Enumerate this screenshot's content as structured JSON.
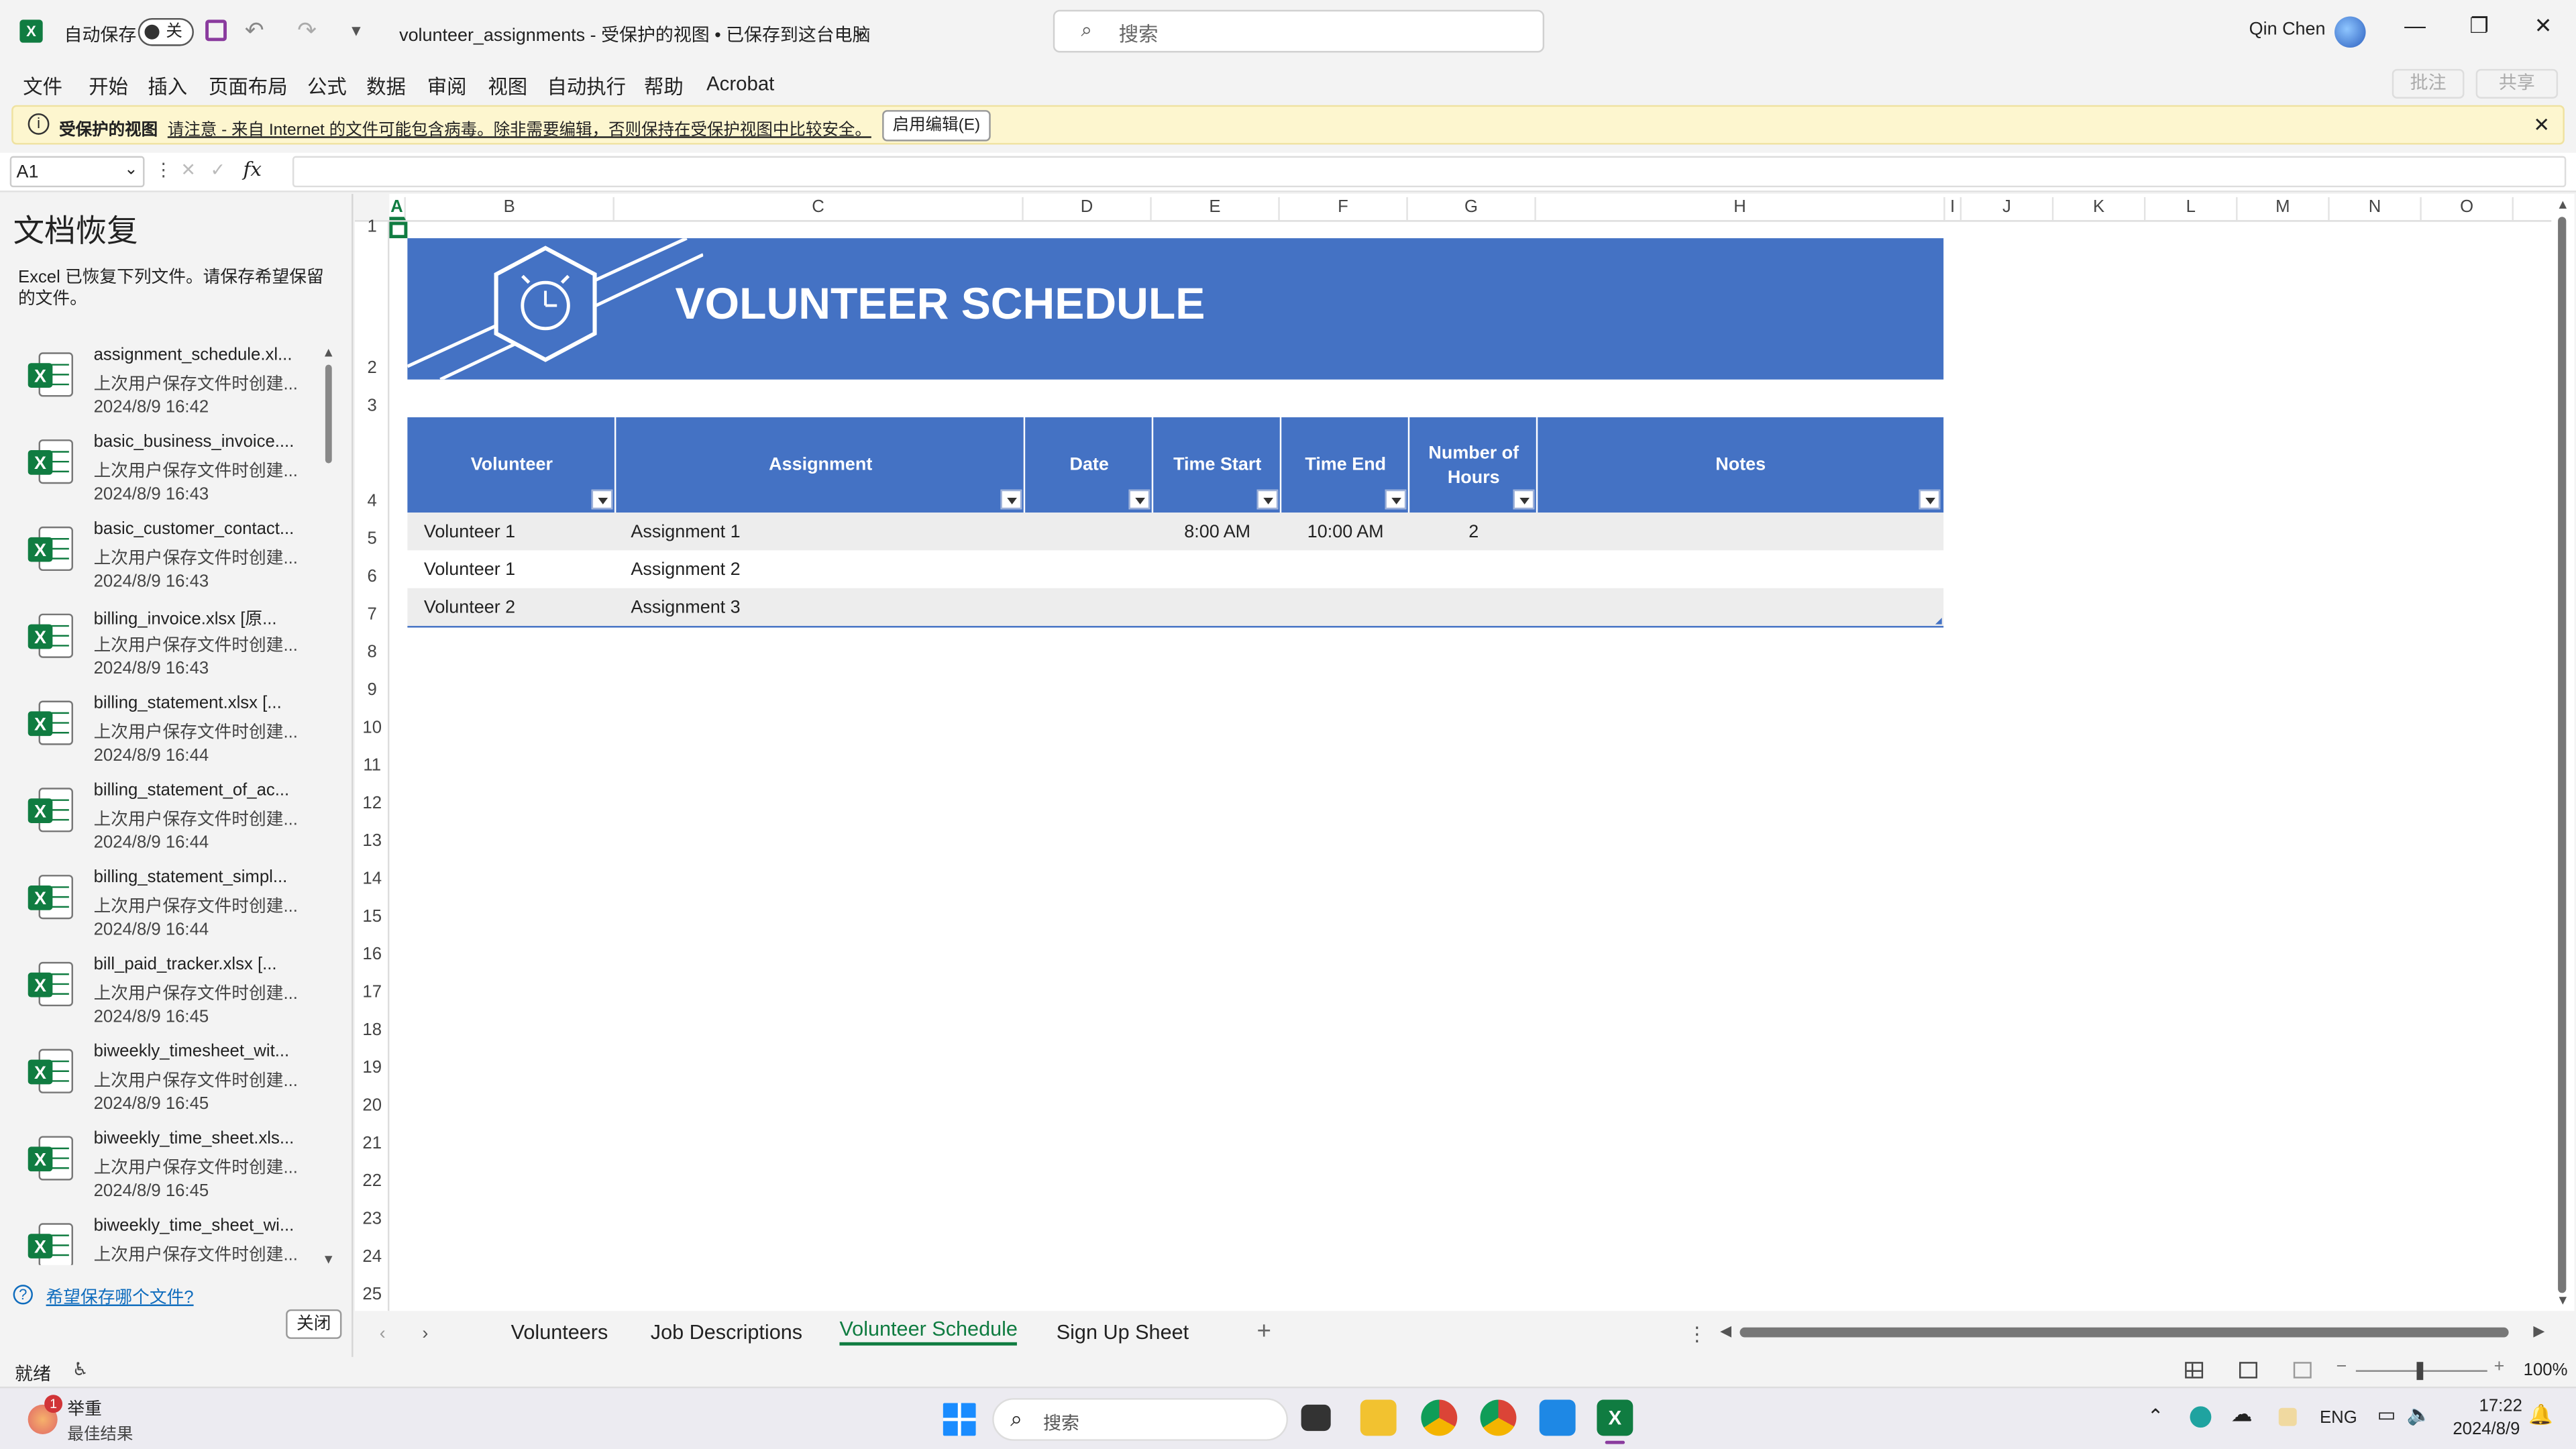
{
  "titlebar": {
    "autosave_label": "自动保存",
    "toggle_state": "关",
    "doc_title": "volunteer_assignments  -  受保护的视图 • 已保存到这台电脑",
    "search_placeholder": "搜索",
    "user_name": "Qin Chen"
  },
  "menu": {
    "items": [
      "文件",
      "开始",
      "插入",
      "页面布局",
      "公式",
      "数据",
      "审阅",
      "视图",
      "自动执行",
      "帮助",
      "Acrobat"
    ],
    "comment_btn": "批注",
    "share_btn": "共享"
  },
  "protected_bar": {
    "title": "受保护的视图",
    "message": "请注意 - 来自 Internet 的文件可能包含病毒。除非需要编辑，否则保持在受保护视图中比较安全。",
    "enable_button": "启用编辑(E)"
  },
  "formula_bar": {
    "name_box": "A1",
    "fx": "fx",
    "value": ""
  },
  "recovery": {
    "title": "文档恢复",
    "description": "Excel 已恢复下列文件。请保存希望保留的文件。",
    "items": [
      {
        "name": "assignment_schedule.xl...",
        "sub": "上次用户保存文件时创建...",
        "date": "2024/8/9 16:42"
      },
      {
        "name": "basic_business_invoice....",
        "sub": "上次用户保存文件时创建...",
        "date": "2024/8/9 16:43"
      },
      {
        "name": "basic_customer_contact...",
        "sub": "上次用户保存文件时创建...",
        "date": "2024/8/9 16:43"
      },
      {
        "name": "billing_invoice.xlsx  [原...",
        "sub": "上次用户保存文件时创建...",
        "date": "2024/8/9 16:43"
      },
      {
        "name": "billing_statement.xlsx  [...",
        "sub": "上次用户保存文件时创建...",
        "date": "2024/8/9 16:44"
      },
      {
        "name": "billing_statement_of_ac...",
        "sub": "上次用户保存文件时创建...",
        "date": "2024/8/9 16:44"
      },
      {
        "name": "billing_statement_simpl...",
        "sub": "上次用户保存文件时创建...",
        "date": "2024/8/9 16:44"
      },
      {
        "name": "bill_paid_tracker.xlsx  [...",
        "sub": "上次用户保存文件时创建...",
        "date": "2024/8/9 16:45"
      },
      {
        "name": "biweekly_timesheet_wit...",
        "sub": "上次用户保存文件时创建...",
        "date": "2024/8/9 16:45"
      },
      {
        "name": "biweekly_time_sheet.xls...",
        "sub": "上次用户保存文件时创建...",
        "date": "2024/8/9 16:45"
      },
      {
        "name": "biweekly_time_sheet_wi...",
        "sub": "上次用户保存文件时创建...",
        "date": ""
      }
    ],
    "help_link": "希望保存哪个文件?",
    "close_button": "关闭"
  },
  "sheet": {
    "columns": [
      "A",
      "B",
      "C",
      "D",
      "E",
      "F",
      "G",
      "H",
      "I",
      "J",
      "K",
      "L",
      "M",
      "N",
      "O"
    ],
    "rows": [
      "1",
      "2",
      "3",
      "4",
      "5",
      "6",
      "7",
      "8",
      "9",
      "10",
      "11",
      "12",
      "13",
      "14",
      "15",
      "16",
      "17",
      "18",
      "19",
      "20",
      "21",
      "22",
      "23",
      "24",
      "25"
    ],
    "banner_title": "VOLUNTEER SCHEDULE",
    "headers": [
      "Volunteer",
      "Assignment",
      "Date",
      "Time Start",
      "Time End",
      "Number of Hours",
      "Notes"
    ],
    "data": [
      [
        "Volunteer 1",
        "Assignment 1",
        "",
        "8:00 AM",
        "10:00 AM",
        "2",
        ""
      ],
      [
        "Volunteer 1",
        "Assignment 2",
        "",
        "",
        "",
        "",
        ""
      ],
      [
        "Volunteer 2",
        "Assignment 3",
        "",
        "",
        "",
        "",
        ""
      ]
    ],
    "accent_color": "#4472c4"
  },
  "tabs": {
    "items": [
      "Volunteers",
      "Job Descriptions",
      "Volunteer Schedule",
      "Sign Up Sheet"
    ],
    "active": "Volunteer Schedule"
  },
  "status": {
    "ready": "就绪",
    "zoom": "100%"
  },
  "taskbar": {
    "weather_title": "举重",
    "weather_sub": "最佳结果",
    "search_placeholder": "搜索",
    "lang": "ENG",
    "time": "17:22",
    "date": "2024/8/9",
    "notif_count": "1"
  }
}
